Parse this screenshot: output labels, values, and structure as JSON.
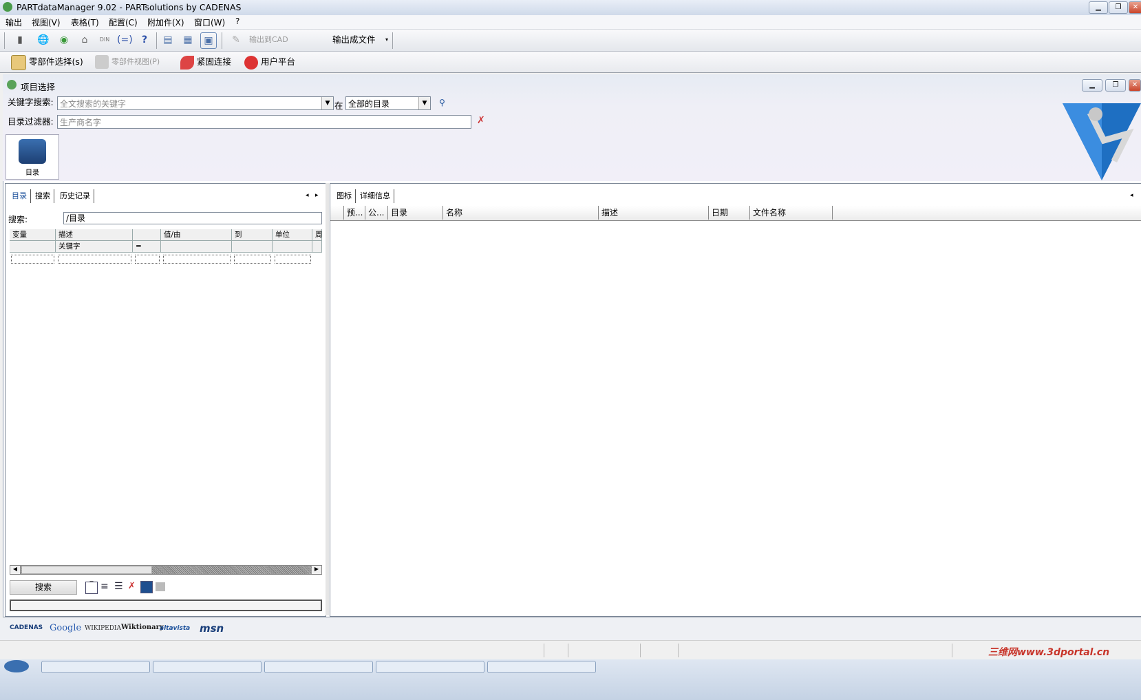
{
  "window": {
    "title": "PARTdataManager 9.02 - PARTsolutions by CADENAS"
  },
  "menu": [
    "输出",
    "视图(V)",
    "表格(T)",
    "配置(C)",
    "附加件(X)",
    "窗口(W)",
    "?"
  ],
  "toolbar1": {
    "output_cad": "输出到CAD",
    "output_file": "输出成文件"
  },
  "toolbar2": {
    "part_select": "零部件选择(s)",
    "part_view": "零部件视图(P)",
    "fastener": "紧固连接",
    "user_platform": "用户平台"
  },
  "inner": {
    "title": "项目选择",
    "keyword_label": "关键字搜索:",
    "keyword_placeholder": "全文搜索的关键字",
    "in_label": "在",
    "catalog_select": "全部的目录",
    "filter_label": "目录过滤器:",
    "filter_placeholder": "生产商名字",
    "catalog_button": "目录"
  },
  "left": {
    "tabs": [
      "目录",
      "搜索",
      "历史记录"
    ],
    "search_label": "搜索:",
    "search_path": "/目录",
    "grid_headers": [
      "变量",
      "描述",
      "",
      "值/由",
      "到",
      "单位",
      "周"
    ],
    "grid_row": [
      "",
      "关键字",
      "=",
      "",
      "",
      "",
      ""
    ],
    "search_button": "搜索"
  },
  "right": {
    "tabs": [
      "图标",
      "详细信息"
    ],
    "columns": [
      "预...",
      "公...",
      "目录",
      "名称",
      "描述",
      "日期",
      "文件名称"
    ]
  },
  "links": [
    "CADENAS",
    "Google",
    "WIKIPEDIA",
    "Wiktionary",
    "altavista",
    "msn"
  ],
  "watermark": "三维网www.3dportal.cn"
}
